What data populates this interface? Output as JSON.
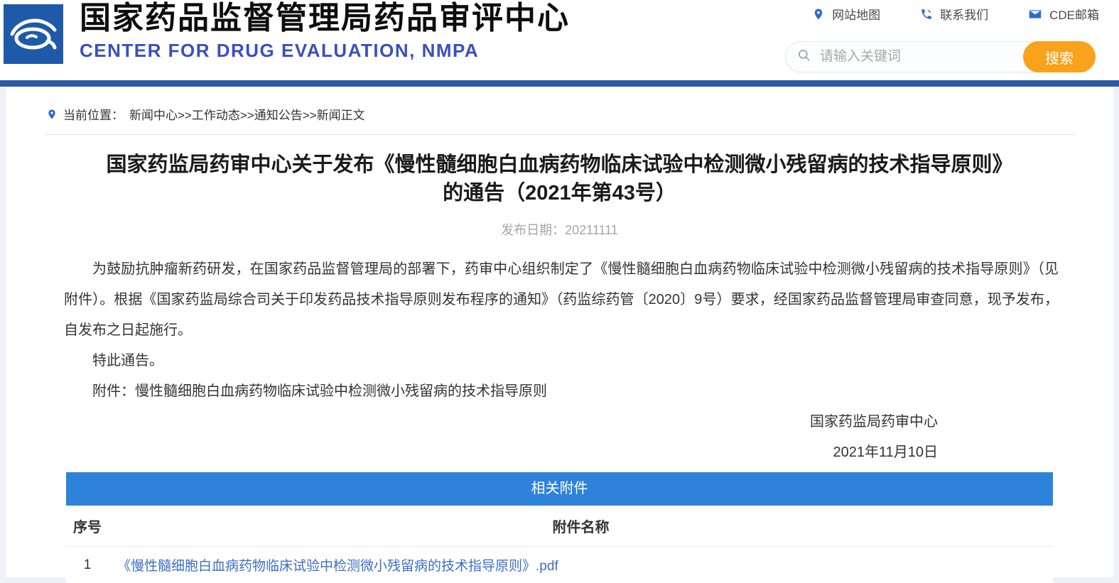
{
  "header": {
    "title_cn": "国家药品监督管理局药品审评中心",
    "title_en": "CENTER FOR DRUG EVALUATION, NMPA",
    "quick_links": [
      {
        "label": "网站地图",
        "icon": "location-pin-icon"
      },
      {
        "label": "联系我们",
        "icon": "phone-icon"
      },
      {
        "label": "CDE邮箱",
        "icon": "mail-icon"
      }
    ],
    "search": {
      "placeholder": "请输入关键词",
      "button_label": "搜索"
    }
  },
  "breadcrumb": {
    "prefix": "当前位置：",
    "path": "新闻中心>>工作动态>>通知公告>>新闻正文"
  },
  "article": {
    "title_line1": "国家药监局药审中心关于发布《慢性髓细胞白血病药物临床试验中检测微小残留病的技术指导原则》",
    "title_line2": "的通告（2021年第43号）",
    "date_label": "发布日期：",
    "date_value": "20211111",
    "paragraphs": [
      "为鼓励抗肿瘤新药研发，在国家药品监督管理局的部署下，药审中心组织制定了《慢性髓细胞白血病药物临床试验中检测微小残留病的技术指导原则》（见附件）。根据《国家药监局综合司关于印发药品技术指导原则发布程序的通知》（药监综药管〔2020〕9号）要求，经国家药品监督管理局审查同意，现予发布，自发布之日起施行。",
      "特此通告。",
      "附件：慢性髓细胞白血病药物临床试验中检测微小残留病的技术指导原则"
    ],
    "signature": {
      "org": "国家药监局药审中心",
      "date": "2021年11月10日"
    }
  },
  "attachments": {
    "title": "相关附件",
    "columns": {
      "index": "序号",
      "name": "附件名称"
    },
    "rows": [
      {
        "index": "1",
        "name": "《慢性髓细胞白血病药物临床试验中检测微小残留病的技术指导原则》.pdf"
      }
    ]
  },
  "colors": {
    "top_bar_blue": "#2b5ba6",
    "table_header_blue": "#2e82d9",
    "search_button_orange": "#f9a21c",
    "link_blue": "#3d6dc5",
    "logo_blue": "#1e5aa9",
    "icon_blue": "#2e6ad3",
    "title_en_blue": "#3a4fc0"
  }
}
